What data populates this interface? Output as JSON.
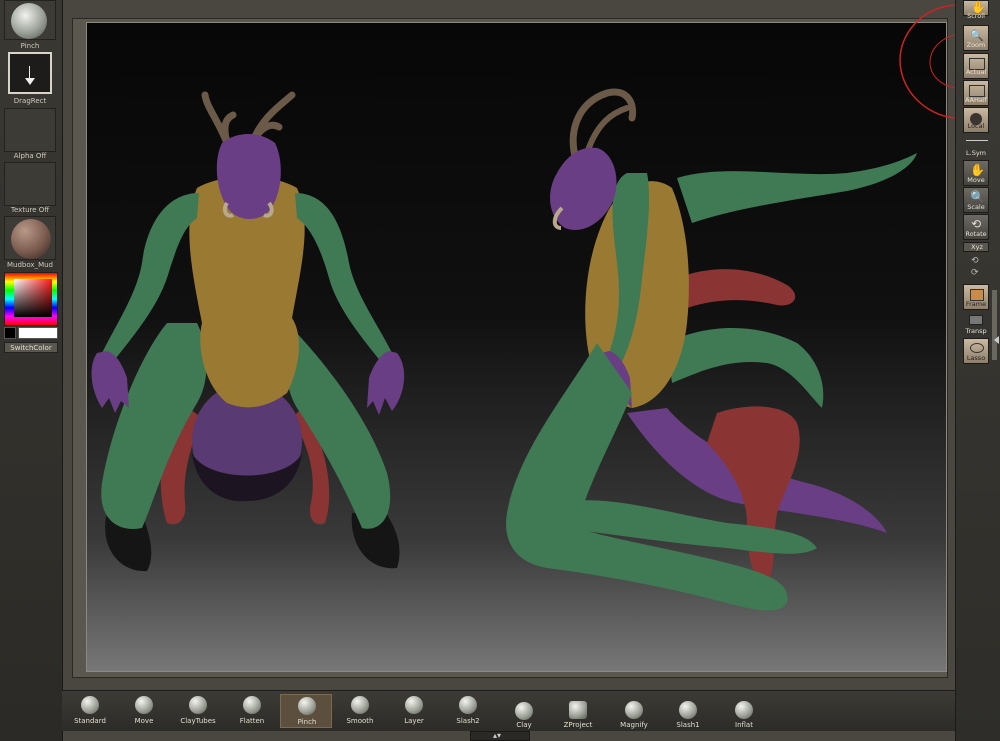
{
  "left_tray": {
    "brush_label": "Pinch",
    "stroke_label": "DragRect",
    "alpha_label": "Alpha Off",
    "texture_label": "Texture Off",
    "material_label": "Mudbox_Mud",
    "switch_color_label": "SwitchColor"
  },
  "right_shelf": [
    {
      "label": "Scroll",
      "icon": "hand-icon"
    },
    {
      "label": "Zoom",
      "icon": "magnifier-icon"
    },
    {
      "label": "Actual",
      "icon": "actual-icon"
    },
    {
      "label": "AAHalf",
      "icon": "aahalf-icon"
    },
    {
      "label": "Local",
      "icon": "local-icon"
    },
    {
      "label": "L.Sym",
      "icon": "symmetry-icon"
    },
    {
      "label": "Move",
      "icon": "move-icon"
    },
    {
      "label": "Scale",
      "icon": "scale-icon"
    },
    {
      "label": "Rotate",
      "icon": "rotate-icon"
    },
    {
      "label": "Xyz",
      "icon": "xyz-icon"
    },
    {
      "label": "Frame",
      "icon": "frame-icon"
    },
    {
      "label": "Transp",
      "icon": "transp-icon"
    },
    {
      "label": "Lasso",
      "icon": "lasso-icon"
    }
  ],
  "brushes": [
    {
      "label": "Standard"
    },
    {
      "label": "Move"
    },
    {
      "label": "ClayTubes"
    },
    {
      "label": "Flatten"
    },
    {
      "label": "Pinch",
      "active": true
    },
    {
      "label": "Smooth"
    },
    {
      "label": "Layer"
    },
    {
      "label": "Slash2"
    },
    {
      "label": "Clay"
    },
    {
      "label": "ZProject"
    },
    {
      "label": "Magnify"
    },
    {
      "label": "Slash1"
    },
    {
      "label": "Inflat"
    }
  ],
  "colors": {
    "purple": "#6a3e84",
    "green": "#3f7a55",
    "yellow": "#9a7a32",
    "red": "#8a3434",
    "horn": "#6b5a48"
  }
}
